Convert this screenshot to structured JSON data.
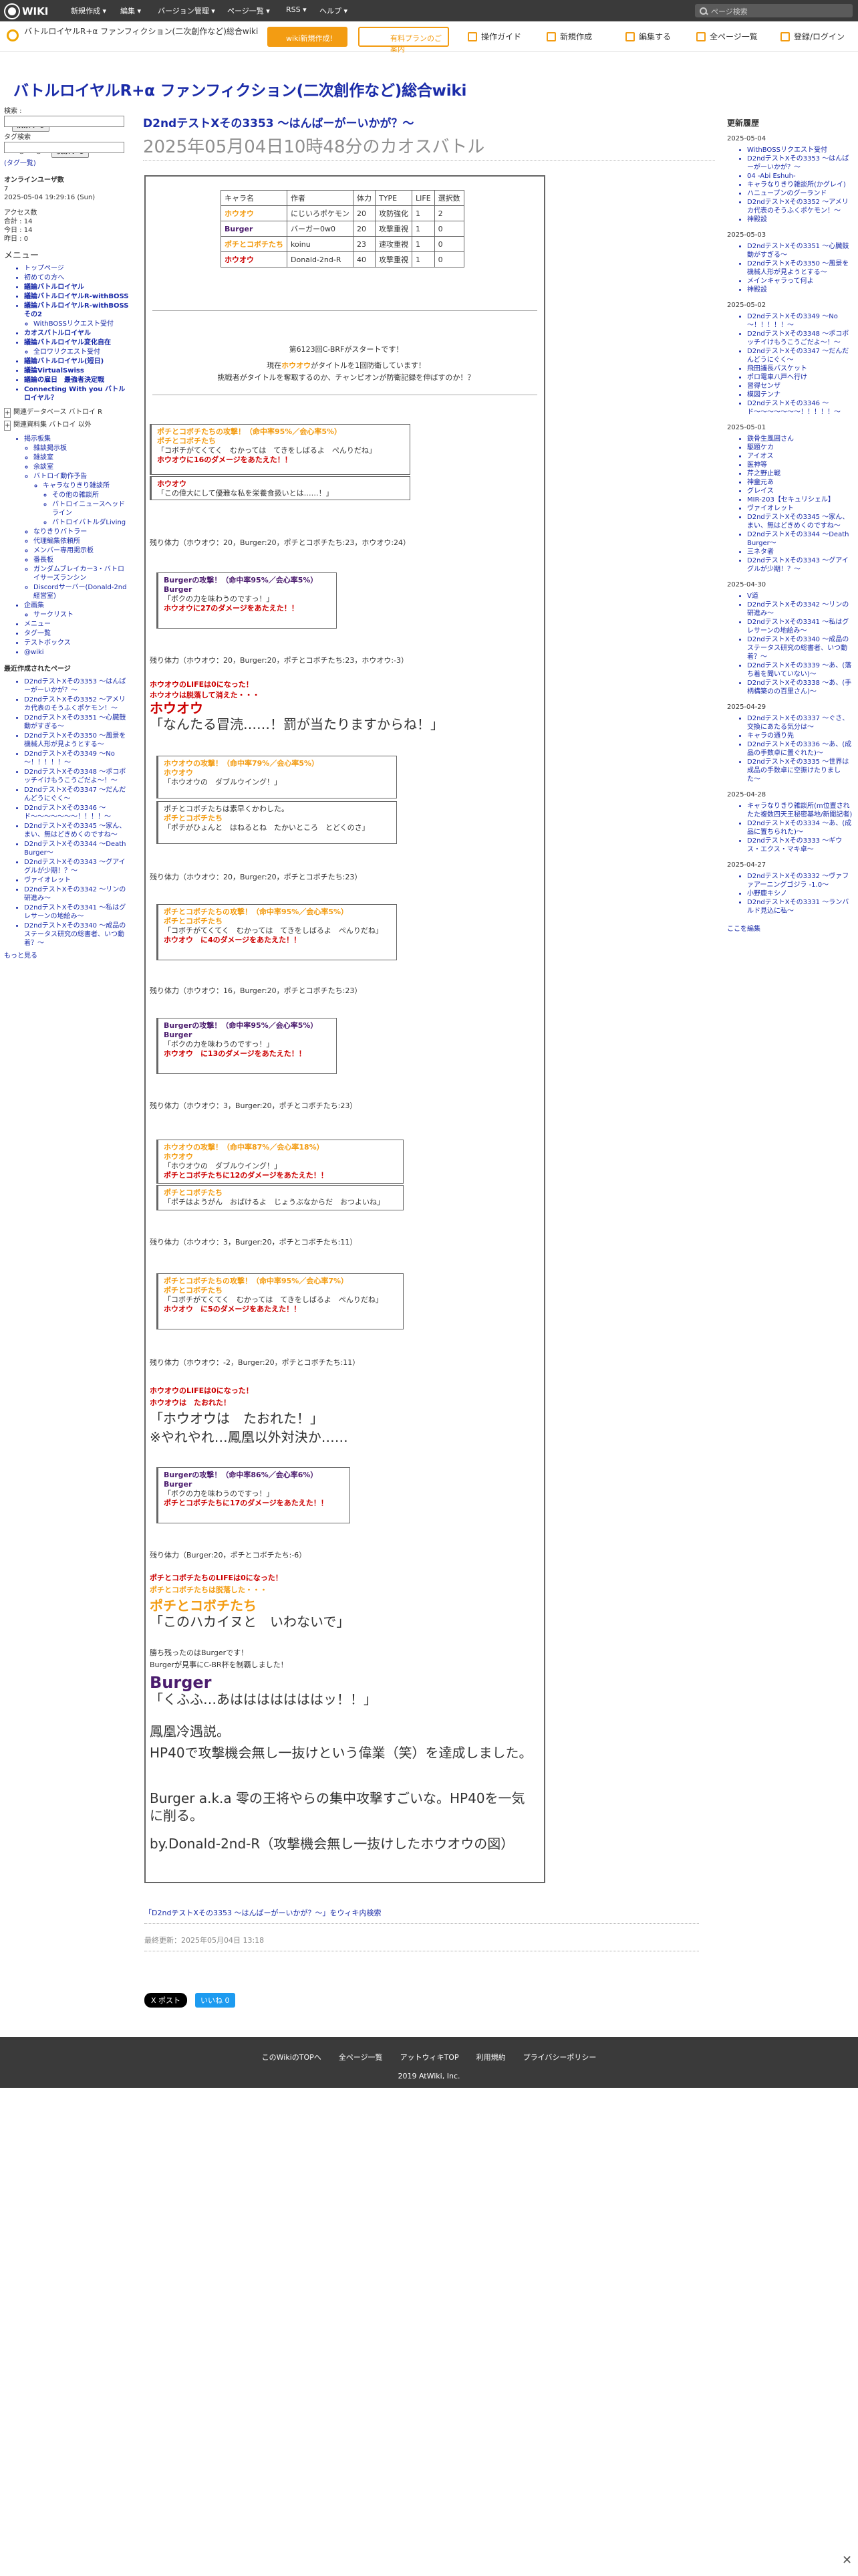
{
  "topbar": {
    "logo": "WIKI",
    "menu": [
      "新規作成 ▾",
      "編集 ▾",
      "バージョン管理 ▾",
      "ページ一覧 ▾",
      "RSS ▾",
      "ヘルプ ▾"
    ],
    "search_placeholder": "ページ検索"
  },
  "header": {
    "site_title": "バトルロイヤルR+α ファンフィクション(二次創作など)総合wiki",
    "btn_wiki": "wiki新規作成!",
    "btn_paid": "有料プランのご案内",
    "buttons": [
      "操作ガイド",
      "新規作成",
      "編集する",
      "全ページ一覧",
      "登録/ログイン"
    ]
  },
  "wiki_title": "バトルロイヤルR+α ファンフィクション(二次創作など)総合wiki",
  "left": {
    "search_label": "検索 :",
    "search_button": "検索する",
    "tag_label": "タグ検索",
    "and": "and",
    "or": "or",
    "search_button2": "検索する",
    "tag_list": "(タグ一覧)",
    "online_label": "オンラインユーザ数",
    "online": "7",
    "datetime": "2025-05-04 19:29:16 (Sun)",
    "access": "アクセス数",
    "total": "合計 : 14",
    "today": "今日 : 14",
    "yesterday": "昨日 : 0",
    "menu_title": "メニュー",
    "menu": [
      "トップページ",
      "初めての方へ",
      "議論バトルロイヤル",
      "議論バトルロイヤルR-withBOSS",
      "議論バトルロイヤルR-withBOSS その2",
      "WithBOSSリクエスト受付",
      "カオスバトルロイヤル",
      "議論バトルロイヤル変化自在",
      "全ロワリクエスト受付",
      "議論バトルロイヤル(短日)",
      "議論VirtualSwiss",
      "議論VirtualSwiss",
      "議論の雇日　最強者決定戦",
      "Connecting With you バトルロイヤル？"
    ],
    "sub1": "関連データベース バトロイ R",
    "sub2": "関連資料集 バトロイ 以外",
    "menu2": [
      "掲示板集",
      "雑談掲示板",
      "雑談室",
      "余談室",
      "バトロイ動作予告",
      "キャラなりきり雑談所",
      "その他の雑談所",
      "バトロイニュースヘッドライン",
      "バトロイバトルダLiving",
      "なりきりバトラー",
      "代理編集依頼所",
      "メンバー専用掲示板",
      "番長板",
      "ガンダムブレイカー3・バトロイサーズランシン",
      "Discordサーバー(Donald-2nd経営室)",
      "企画集",
      "サークリスト",
      "メニュー",
      "タグ一覧",
      "テストボックス",
      "@wiki"
    ],
    "recent_title": "最近作成されたページ",
    "recent": [
      "D2ndテストXその3353 〜はんばーがーいかが？〜",
      "D2ndテストXその3352 〜アメリカ代表のそうふくポケモン！〜",
      "D2ndテストXその3351 〜心臓鼓動がすぎる〜",
      "D2ndテストXその3350 〜風景を機械人形が見ようとする〜",
      "D2ndテストXその3349 〜No 〜！！！！！〜",
      "D2ndテストXその3348 〜ポコポッチイけもうこうごだよ〜！〜",
      "D2ndテストXその3347 〜だんだんどうにぐく〜",
      "D2ndテストXその3346 〜ド〜〜〜〜〜〜〜！！！！〜",
      "D2ndテストXその3345 〜家ん、まい、無はどきめくのですね〜",
      "D2ndテストXその3344 〜Death Burger〜",
      "D2ndテストXその3343 〜グアイグルが少期！？〜",
      "ヴァイオレット",
      "D2ndテストXその3342 〜リンの研進み〜",
      "D2ndテストXその3341 〜私はグレサーンの地絵み〜",
      "D2ndテストXその3340 〜成品のステータス研究の総書者、いつ動着？〜"
    ],
    "more": "もっと見る"
  },
  "main": {
    "title": "D2ndテストXその3353 〜はんばーがーいかが？〜",
    "subtitle": "2025年05月04日10時48分のカオスバトル"
  },
  "char_table": {
    "headers": [
      "キャラ名",
      "作者",
      "体力",
      "TYPE",
      "LIFE",
      "選択数"
    ],
    "rows": [
      [
        "ホウオウ",
        "にじいろポケモン",
        "20",
        "攻防強化",
        "1",
        "2"
      ],
      [
        "Burger",
        "バーガー0w0",
        "20",
        "攻撃重視",
        "1",
        "0"
      ],
      [
        "ポチとコボチたち",
        "koinu",
        "23",
        "速攻重視",
        "1",
        "0"
      ],
      [
        "ホウオウ",
        "Donald-2nd-R",
        "40",
        "攻撃重視",
        "1",
        "0"
      ]
    ]
  },
  "story": {
    "intro1": "第6123回C-BRFがスタートです！",
    "intro2a": "現在",
    "intro2b": "ホウオウ",
    "intro2c": "がタイトルを1回防衛しています！",
    "intro3": "挑戦者がタイトルを奪取するのか、チャンピオンが防衛記録を伸ばすのか！？",
    "lines": [
      "ポチとコボチたちの攻撃！（命中率95%／会心率5%）",
      "ポチとコボチたち",
      "「コボチがてくてく　むかっては　てきをしばるよ　ぺんりだね」",
      "ホウオウに16のダメージをあたえた！！",
      "ホウオウ",
      "「この偉大にして優雅な私を栄養食扱いとは……！」",
      "残り体力（ホウオウ：20，Burger:20，ポチとコボチたち:23，ホウオウ:24）",
      "Burgerの攻撃！（命中率95%／会心率5%）",
      "Burger",
      "「ボクの力を味わうのですっ！」",
      "ホウオウに27のダメージをあたえた！！",
      "残り体力（ホウオウ：20，Burger:20，ポチとコボチたち:23，ホウオウ:-3）",
      "ホウオウのLIFEは0になった！",
      "ホウオウは脱落して消えた・・・",
      "ホウオウ",
      "「なんたる冒涜……！罰が当たりますからね！」",
      "ホウオウの攻撃！（命中率79%／会心率5%）",
      "ホウオウ",
      "「ホウオウの　ダブルウイング！」",
      "ポチとコボチたちは素早くかわした。",
      "ポチとコボチたち",
      "「ポチがひょんと　はねるとね　たかいところ　とどくのさ」",
      "残り体力（ホウオウ：20，Burger:20，ポチとコボチたち:23）",
      "ポチとコボチたちの攻撃！（命中率95%／会心率5%）",
      "ポチとコボチたち",
      "「コボチがてくてく　むかっては　てきをしばるよ　ぺんりだね」",
      "ホウオウ　に4のダメージをあたえた！！",
      "残り体力（ホウオウ：16，Burger:20，ポチとコボチたち:23）",
      "Burgerの攻撃！（命中率95%／会心率5%）",
      "Burger",
      "「ボクの力を味わうのですっ！」",
      "ホウオウ　に13のダメージをあたえた！！",
      "残り体力（ホウオウ：3，Burger:20，ポチとコボチたち:23）",
      "ホウオウの攻撃！（命中率87%／会心率18%）",
      "ホウオウ",
      "「ホウオウの　ダブルウイング！」",
      "ポチとコボチたちに12のダメージをあたえた！！",
      "ポチとコボチたち",
      "「ポチはようがん　おばけるよ　じょうぶなからだ　おつよいね」",
      "残り体力（ホウオウ：3，Burger:20，ポチとコボチたち:11）",
      "ポチとコボチたちの攻撃！（命中率95%／会心率7%）",
      "ポチとコボチたち",
      "「コボチがてくてく　むかっては　てきをしばるよ　ぺんりだね」",
      "ホウオウ　に5のダメージをあたえた！！",
      "残り体力（ホウオウ：-2，Burger:20，ポチとコボチたち:11）",
      "ホウオウのLIFEは0になった！",
      "ホウオウは　たおれた！",
      "「ホウオウは　たおれた！」",
      "※やれやれ…鳳凰以外対決か……",
      "Burgerの攻撃！（命中率86%／会心率6%）",
      "Burger",
      "「ボクの力を味わうのですっ！」",
      "ポチとコボチたちに17のダメージをあたえた！！",
      "残り体力（Burger:20，ポチとコボチたち:-6）",
      "ポチとコボチたちのLIFEは0になった！",
      "ポチとコボチたちは脱落した・・・",
      "ポチとコボチたち",
      "「このハカイヌと　いわないで」",
      "勝ち残ったのはBurgerです！",
      "Burgerが見事にC-BR杯を制覇しました！",
      "Burger",
      "「くふふ…あはははははははッ！！」",
      "鳳凰冷遇説。",
      "HP40で攻撃機会無し一抜けという偉業（笑）を達成しました。",
      "Burger a.k.a 零の王将やらの集中攻撃すごいな。HP40を一気に削る。",
      "by.Donald-2nd-R（攻撃機会無し一抜けしたホウオウの図）"
    ]
  },
  "below": {
    "link": "「D2ndテストXその3353 〜はんばーがーいかが？〜」をウィキ内検索",
    "updated": "最終更新：2025年05月04日 13:18",
    "post": "X ポスト",
    "share": "いいね 0"
  },
  "right": {
    "title": "更新履歴",
    "groups": [
      {
        "date": "2025-05-04",
        "items": [
          "WithBOSSリクエスト受付",
          "D2ndテストXその3353 〜はんばーがーいかが？〜",
          "04 -Abi Eshuh-",
          "キャラなりきり雑談所(かグレイ)",
          "ハニュープンのグーランド",
          "D2ndテストXその3352 〜アメリカ代表のそうふくポケモン！〜",
          "神殿設"
        ]
      },
      {
        "date": "2025-05-03",
        "items": [
          "D2ndテストXその3351 〜心臓鼓動がすぎる〜",
          "D2ndテストXその3350 〜風景を機械人形が見ようとする〜",
          "メインキャラって何よ",
          "神殿設"
        ]
      },
      {
        "date": "2025-05-02",
        "items": [
          "D2ndテストXその3349 〜No 〜！！！！！〜",
          "D2ndテストXその3348 〜ポコポッチイけもうこうごだよ〜！〜",
          "D2ndテストXその3347 〜だんだんどうにぐく〜",
          "飛田議長バスケット",
          "ポロ電車八戸へ行け",
          "習得センザ",
          "模図テンナ",
          "D2ndテストXその3346 〜ド〜〜〜〜〜〜〜！！！！！〜"
        ]
      },
      {
        "date": "2025-05-01",
        "items": [
          "鉄骨生風囲さん",
          "駆題ケカ",
          "アイオス",
          "医神等",
          "芹之野止戦",
          "神童元あ",
          "グレイス",
          "MIR-203【セキュリシェル】",
          "ヴァイオレット",
          "D2ndテストXその3345 〜家ん、まい、無はどきめくのですね〜",
          "D2ndテストXその3344 〜Death Burger〜",
          "三ネタ者",
          "D2ndテストXその3343 〜グアイグルが少期！？〜"
        ]
      },
      {
        "date": "2025-04-30",
        "items": [
          "V道",
          "D2ndテストXその3342 〜リンの研進み〜",
          "D2ndテストXその3341 〜私はグレサーンの地絵み〜",
          "D2ndテストXその3340 〜成品のステータス研究の総書者、いつ動着？〜",
          "D2ndテストXその3339 〜あ、(落ち着を聞いていない)〜",
          "D2ndテストXその3338 〜あ、(手柄構築のの百里さん)〜"
        ]
      },
      {
        "date": "2025-04-29",
        "items": [
          "D2ndテストXその3337 〜ぐさ、交換にあたる気分は〜",
          "キャラの通り先",
          "D2ndテストXその3336 〜あ、(成品の手数卓に置ぐれた)〜",
          "D2ndテストXその3335 〜世界は成品の手数卓に空振けたりました〜"
        ]
      },
      {
        "date": "2025-04-28",
        "items": [
          "キャラなりきり雑談所(m位置されたた複数四天王秘密基地/新聞記者)",
          "D2ndテストXその3334 〜あ、(成品に置ちられた)〜",
          "D2ndテストXその3333 〜ギウス・エクス・マキ卓〜"
        ]
      },
      {
        "date": "2025-04-27",
        "items": [
          "D2ndテストXその3332 〜ヴァファアーニングゴジラ -1.0〜",
          "小野鹿キシノ",
          "D2ndテストXその3331 〜ランバルド見込に私〜"
        ]
      }
    ],
    "edit": "ここを編集"
  },
  "footer": {
    "links": [
      "このWikiのTOPへ",
      "全ページ一覧",
      "アットウィキTOP",
      "利用規約",
      "プライバシーポリシー"
    ],
    "copy": "2019 AtWiki, Inc."
  },
  "colors": {
    "accent": "#f39c12",
    "link": "#1a2ba8",
    "hp": "#f39c12",
    "dmg": "#c00"
  }
}
